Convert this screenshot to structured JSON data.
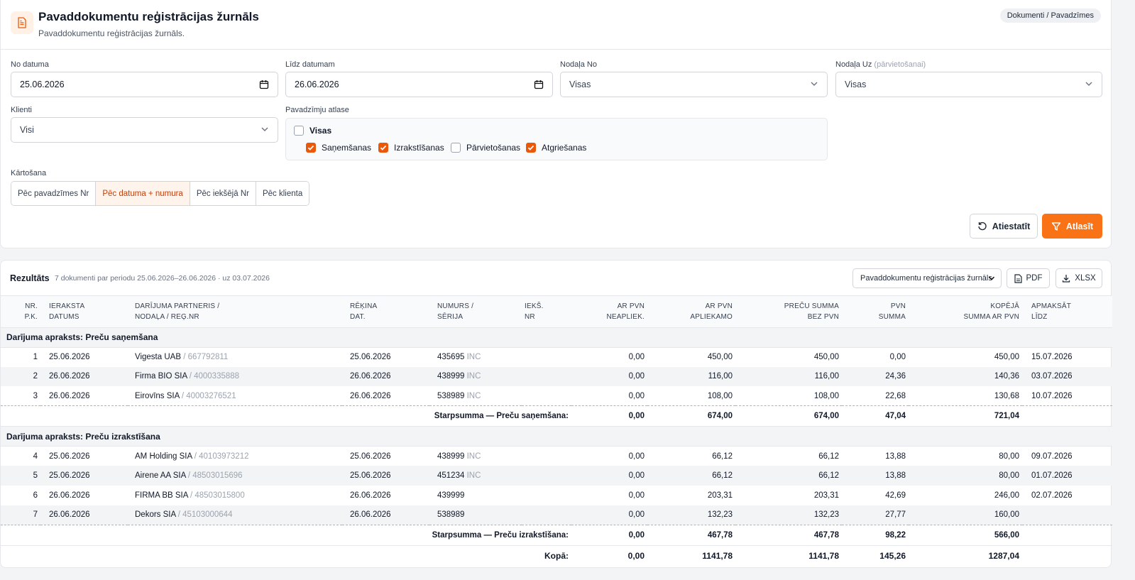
{
  "header": {
    "title": "Pavaddokumentu reģistrācijas žurnāls",
    "subtitle": "Pavaddokumentu reģistrācijas žurnāls.",
    "breadcrumb": "Dokumenti / Pavadzīmes"
  },
  "filters": {
    "from_label": "No datuma",
    "from_value": "25.06.2026",
    "to_label": "Līdz datumam",
    "to_value": "26.06.2026",
    "dept_from_label": "Nodaļa No",
    "dept_from_value": "Visas",
    "dept_to_label": "Nodaļa Uz",
    "dept_to_hint": "(pārvietošanai)",
    "dept_to_value": "Visas",
    "client_label": "Klienti",
    "client_value": "Visi",
    "selection_label": "Pavadzīmju atlase",
    "options": {
      "all": {
        "label": "Visas",
        "checked": false
      },
      "receiving": {
        "label": "Saņemšanas",
        "checked": true
      },
      "issuing": {
        "label": "Izrakstīšanas",
        "checked": true
      },
      "moving": {
        "label": "Pārvietošanas",
        "checked": false
      },
      "returns": {
        "label": "Atgriešanas",
        "checked": true
      }
    },
    "sort_label": "Kārtošana",
    "sort_options": [
      "Pēc pavadzīmes Nr",
      "Pēc datuma + numura",
      "Pēc iekšējā Nr",
      "Pēc klienta"
    ],
    "sort_active": "Pēc datuma + numura",
    "reset_label": "Atiestatīt",
    "apply_label": "Atlasīt"
  },
  "results": {
    "title": "Rezultāts",
    "info": "7 dokumenti par periodu 25.06.2026–26.06.2026 · uz 03.07.2026",
    "report_select": "Pavaddokumentu reģistrācijas žurnāls",
    "pdf_label": "PDF",
    "xlsx_label": "XLSX",
    "columns": {
      "nr_1": "Nr.",
      "nr_2": "P.K.",
      "date_1": "Ieraksta",
      "date_2": "datums",
      "partner_1": "Darījuma partneris /",
      "partner_2": "Nodaļa / Reģ.Nr",
      "inv_1": "Rēķina",
      "inv_2": "dat.",
      "num_1": "Numurs /",
      "num_2": "Sērija",
      "int_1": "Iekš.",
      "int_2": "Nr",
      "nonvat_1": "Ar PVN",
      "nonvat_2": "neapliek.",
      "vat_1": "Ar PVN",
      "vat_2": "apliekamo",
      "net_1": "Preču summa",
      "net_2": "bez PVN",
      "pvn_1": "PVN",
      "pvn_2": "summa",
      "tot_1": "Kopējā",
      "tot_2": "summa ar PVN",
      "due_1": "Apmaksāt",
      "due_2": "līdz"
    },
    "groups": [
      {
        "title": "Darījuma apraksts: Preču saņemšana",
        "rows": [
          {
            "nr": "1",
            "date": "25.06.2026",
            "partner": "Vigesta UAB",
            "reg": "/ 667792811",
            "inv_date": "25.06.2026",
            "number": "435695",
            "series": "INC",
            "internal": "",
            "nonvat": "0,00",
            "vat": "450,00",
            "net": "450,00",
            "pvn": "0,00",
            "total": "450,00",
            "due": "15.07.2026"
          },
          {
            "nr": "2",
            "date": "26.06.2026",
            "partner": "Firma BIO SIA",
            "reg": "/ 4000335888",
            "inv_date": "26.06.2026",
            "number": "438999",
            "series": "INC",
            "internal": "",
            "nonvat": "0,00",
            "vat": "116,00",
            "net": "116,00",
            "pvn": "24,36",
            "total": "140,36",
            "due": "03.07.2026"
          },
          {
            "nr": "3",
            "date": "26.06.2026",
            "partner": "Eirovīns SIA",
            "reg": "/ 40003276521",
            "inv_date": "26.06.2026",
            "number": "538989",
            "series": "INC",
            "internal": "",
            "nonvat": "0,00",
            "vat": "108,00",
            "net": "108,00",
            "pvn": "22,68",
            "total": "130,68",
            "due": "10.07.2026"
          }
        ],
        "subtotal": {
          "label": "Starpsumma — Preču saņemšana:",
          "nonvat": "0,00",
          "vat": "674,00",
          "net": "674,00",
          "pvn": "47,04",
          "total": "721,04"
        }
      },
      {
        "title": "Darījuma apraksts: Preču izrakstīšana",
        "rows": [
          {
            "nr": "4",
            "date": "25.06.2026",
            "partner": "AM Holding SIA",
            "reg": "/ 40103973212",
            "inv_date": "25.06.2026",
            "number": "438999",
            "series": "INC",
            "internal": "",
            "nonvat": "0,00",
            "vat": "66,12",
            "net": "66,12",
            "pvn": "13,88",
            "total": "80,00",
            "due": "09.07.2026"
          },
          {
            "nr": "5",
            "date": "25.06.2026",
            "partner": "Airene AA SIA",
            "reg": "/ 48503015696",
            "inv_date": "25.06.2026",
            "number": "451234",
            "series": "INC",
            "internal": "",
            "nonvat": "0,00",
            "vat": "66,12",
            "net": "66,12",
            "pvn": "13,88",
            "total": "80,00",
            "due": "01.07.2026"
          },
          {
            "nr": "6",
            "date": "26.06.2026",
            "partner": "FIRMA BB SIA",
            "reg": "/ 48503015800",
            "inv_date": "26.06.2026",
            "number": "439999",
            "series": "",
            "internal": "",
            "nonvat": "0,00",
            "vat": "203,31",
            "net": "203,31",
            "pvn": "42,69",
            "total": "246,00",
            "due": "02.07.2026"
          },
          {
            "nr": "7",
            "date": "26.06.2026",
            "partner": "Dekors SIA",
            "reg": "/ 45103000644",
            "inv_date": "26.06.2026",
            "number": "538989",
            "series": "",
            "internal": "",
            "nonvat": "0,00",
            "vat": "132,23",
            "net": "132,23",
            "pvn": "27,77",
            "total": "160,00",
            "due": ""
          }
        ],
        "subtotal": {
          "label": "Starpsumma — Preču izrakstīšana:",
          "nonvat": "0,00",
          "vat": "467,78",
          "net": "467,78",
          "pvn": "98,22",
          "total": "566,00"
        }
      }
    ],
    "total": {
      "label": "Kopā:",
      "nonvat": "0,00",
      "vat": "1141,78",
      "net": "1141,78",
      "pvn": "145,26",
      "total": "1287,04"
    }
  },
  "colors": {
    "accent": "#f97316",
    "accent_dark": "#ea580c"
  }
}
